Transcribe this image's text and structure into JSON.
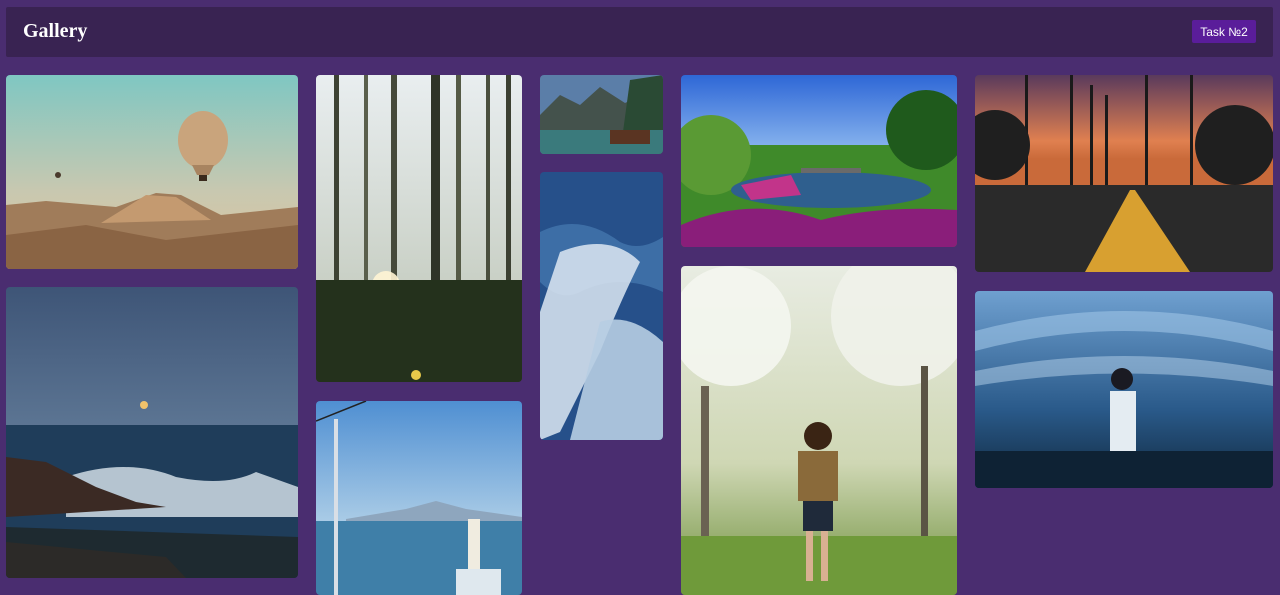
{
  "header": {
    "title": "Gallery",
    "task_button": "Task №2"
  },
  "gallery": {
    "images": [
      {
        "name": "balloon-desert-photo"
      },
      {
        "name": "sea-sunset-photo"
      },
      {
        "name": "forest-sunlight-photo"
      },
      {
        "name": "harbor-sign-photo"
      },
      {
        "name": "mountain-lake-cabin-photo"
      },
      {
        "name": "ocean-waves-photo"
      },
      {
        "name": "garden-pond-photo"
      },
      {
        "name": "child-running-blossom-photo"
      },
      {
        "name": "palm-road-sunset-photo"
      },
      {
        "name": "aquarium-tunnel-photo"
      }
    ]
  }
}
